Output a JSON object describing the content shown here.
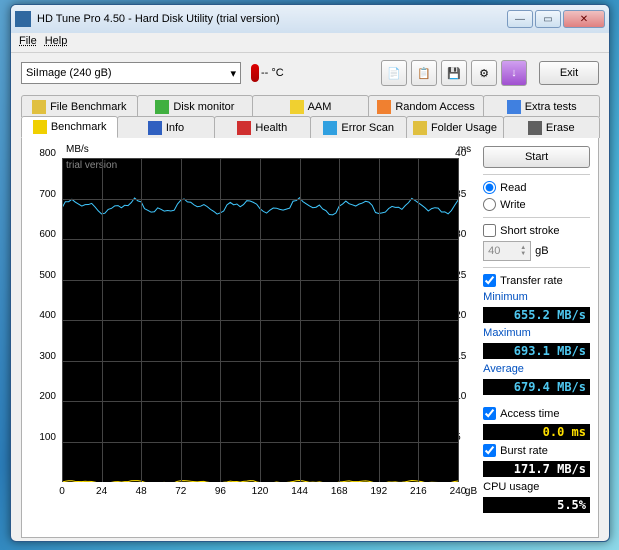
{
  "window": {
    "title": "HD Tune Pro 4.50 - Hard Disk Utility (trial version)"
  },
  "menu": {
    "file": "File",
    "help": "Help"
  },
  "toolbar": {
    "drive": "SiImage   (240 gB)",
    "temp": "-- °C",
    "exit": "Exit"
  },
  "tabs_row1": [
    {
      "label": "File Benchmark",
      "icon": "#e0c040"
    },
    {
      "label": "Disk monitor",
      "icon": "#40b040"
    },
    {
      "label": "AAM",
      "icon": "#f0d030"
    },
    {
      "label": "Random Access",
      "icon": "#f08030"
    },
    {
      "label": "Extra tests",
      "icon": "#4080e0"
    }
  ],
  "tabs_row2": [
    {
      "label": "Benchmark",
      "icon": "#f0d000"
    },
    {
      "label": "Info",
      "icon": "#3060c0"
    },
    {
      "label": "Health",
      "icon": "#d03030"
    },
    {
      "label": "Error Scan",
      "icon": "#30a0e0"
    },
    {
      "label": "Folder Usage",
      "icon": "#e0c040"
    },
    {
      "label": "Erase",
      "icon": "#606060"
    }
  ],
  "side": {
    "start": "Start",
    "read": "Read",
    "write": "Write",
    "short_stroke": "Short stroke",
    "short_stroke_val": "40",
    "short_stroke_unit": "gB",
    "transfer_rate": "Transfer rate",
    "minimum": "Minimum",
    "minimum_val": "655.2 MB/s",
    "maximum": "Maximum",
    "maximum_val": "693.1 MB/s",
    "average": "Average",
    "average_val": "679.4 MB/s",
    "access_time": "Access time",
    "access_time_val": "0.0 ms",
    "burst_rate": "Burst rate",
    "burst_rate_val": "171.7 MB/s",
    "cpu_usage": "CPU usage",
    "cpu_usage_val": "5.5%"
  },
  "chart_data": {
    "type": "line",
    "y_left_label": "MB/s",
    "y_right_label": "ms",
    "x_unit": "gB",
    "watermark": "trial version",
    "y_left_ticks": [
      100,
      200,
      300,
      400,
      500,
      600,
      700,
      800
    ],
    "y_right_ticks": [
      5,
      10,
      15,
      20,
      25,
      30,
      35,
      40
    ],
    "x_ticks": [
      0,
      24,
      48,
      72,
      96,
      120,
      144,
      168,
      192,
      216,
      240
    ],
    "x_range": [
      0,
      240
    ],
    "y_left_range": [
      0,
      800
    ],
    "y_right_range": [
      0,
      40
    ],
    "series": [
      {
        "name": "transfer",
        "axis": "left",
        "color": "#40c8ff",
        "approx_value": 680
      },
      {
        "name": "access",
        "axis": "right",
        "color": "#ffe000",
        "approx_value": 0
      }
    ]
  }
}
